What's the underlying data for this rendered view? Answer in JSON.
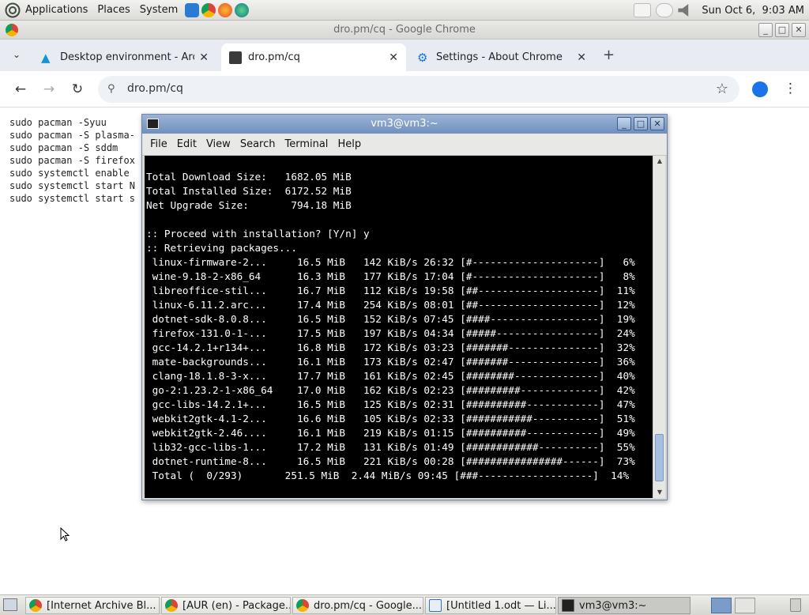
{
  "top_panel": {
    "menus": [
      "Applications",
      "Places",
      "System"
    ],
    "clock": "Sun Oct 6,  9:03 AM"
  },
  "chrome": {
    "window_title": "dro.pm/cq - Google Chrome",
    "tabs": [
      {
        "title": "Desktop environment - Arch",
        "icon": "arch-icon"
      },
      {
        "title": "dro.pm/cq",
        "icon": "page-icon"
      },
      {
        "title": "Settings - About Chrome",
        "icon": "gear-icon"
      }
    ],
    "url": "dro.pm/cq"
  },
  "page_text": "sudo pacman -Syuu\nsudo pacman -S plasma-\nsudo pacman -S sddm\nsudo pacman -S firefox\nsudo systemctl enable\nsudo systemctl start N\nsudo systemctl start s",
  "terminal": {
    "title": "vm3@vm3:~",
    "menu": [
      "File",
      "Edit",
      "View",
      "Search",
      "Terminal",
      "Help"
    ],
    "output": "Total Download Size:   1682.05 MiB\nTotal Installed Size:  6172.52 MiB\nNet Upgrade Size:       794.18 MiB\n\n:: Proceed with installation? [Y/n] y\n:: Retrieving packages...\n linux-firmware-2...     16.5 MiB   142 KiB/s 26:32 [#---------------------]   6%\n wine-9.18-2-x86_64      16.3 MiB   177 KiB/s 17:04 [#---------------------]   8%\n libreoffice-stil...     16.7 MiB   112 KiB/s 19:58 [##--------------------]  11%\n linux-6.11.2.arc...     17.4 MiB   254 KiB/s 08:01 [##--------------------]  12%\n dotnet-sdk-8.0.8...     16.5 MiB   152 KiB/s 07:45 [####------------------]  19%\n firefox-131.0-1-...     17.5 MiB   197 KiB/s 04:34 [#####-----------------]  24%\n gcc-14.2.1+r134+...     16.8 MiB   172 KiB/s 03:23 [#######---------------]  32%\n mate-backgrounds...     16.1 MiB   173 KiB/s 02:47 [#######---------------]  36%\n clang-18.1.8-3-x...     17.7 MiB   161 KiB/s 02:45 [########--------------]  40%\n go-2:1.23.2-1-x86_64    17.0 MiB   162 KiB/s 02:23 [#########-------------]  42%\n gcc-libs-14.2.1+...     16.5 MiB   125 KiB/s 02:31 [##########------------]  47%\n webkit2gtk-4.1-2...     16.6 MiB   105 KiB/s 02:33 [###########-----------]  51%\n webkit2gtk-2.46....     16.1 MiB   219 KiB/s 01:15 [##########------------]  49%\n lib32-gcc-libs-1...     17.2 MiB   131 KiB/s 01:49 [############----------]  55%\n dotnet-runtime-8...     16.5 MiB   221 KiB/s 00:28 [################------]  73%\n Total (  0/293)       251.5 MiB  2.44 MiB/s 09:45 [###-------------------]  14%"
  },
  "taskbar": [
    {
      "label": "[Internet Archive Bl...",
      "icon": "chrome-icon"
    },
    {
      "label": "[AUR (en) - Package...",
      "icon": "chrome-icon"
    },
    {
      "label": "dro.pm/cq - Google...",
      "icon": "chrome-icon"
    },
    {
      "label": "[Untitled 1.odt — Li...",
      "icon": "writer-icon"
    },
    {
      "label": "vm3@vm3:~",
      "icon": "terminal-icon"
    }
  ]
}
